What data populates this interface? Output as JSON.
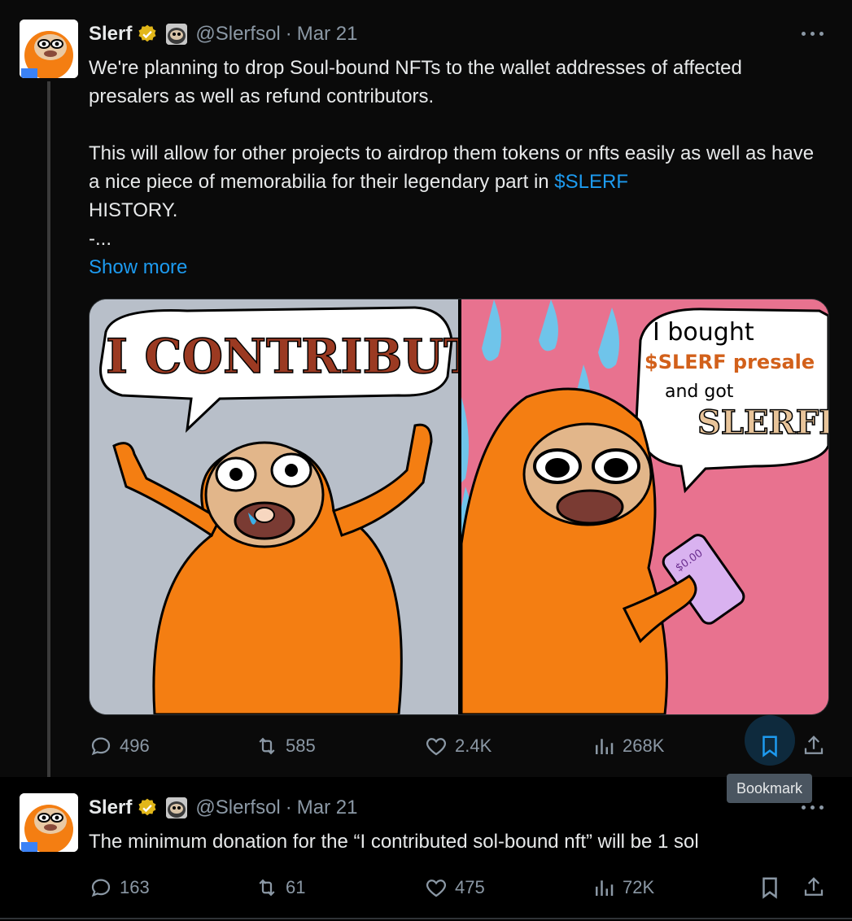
{
  "tweets": [
    {
      "author_name": "Slerf",
      "handle": "@Slerfsol",
      "separator": "·",
      "date": "Mar 21",
      "text_line1": "We're planning to drop Soul-bound NFTs to the wallet addresses of affected presalers as well as refund contributors.",
      "text_line2_pre": "This will allow for other projects to airdrop them tokens or nfts easily as well as have a nice piece of memorabilia for their legendary part in ",
      "cashtag": "$SLERF",
      "text_line2_post": "HISTORY.",
      "text_line3": "-...",
      "show_more": "Show more",
      "image_left_caption": "I CONTRIBUTED",
      "image_right_caption": [
        "I bought",
        "$SLERF presale",
        "and got",
        "SLERFED"
      ],
      "phone_text": "$0.00",
      "stats": {
        "replies": "496",
        "reposts": "585",
        "likes": "2.4K",
        "views": "268K"
      }
    },
    {
      "author_name": "Slerf",
      "handle": "@Slerfsol",
      "separator": "·",
      "date": "Mar 21",
      "text": "The minimum  donation for the “I contributed sol-bound nft” will be 1 sol",
      "stats": {
        "replies": "163",
        "reposts": "61",
        "likes": "475",
        "views": "72K"
      }
    }
  ],
  "tooltip": "Bookmark",
  "colors": {
    "accent": "#1d9bf0",
    "muted": "#8b98a5",
    "verified_gold": "#e2b719",
    "sloth_orange": "#f47e12",
    "panel_gray": "#b8bfc9",
    "panel_pink": "#e8728f"
  }
}
